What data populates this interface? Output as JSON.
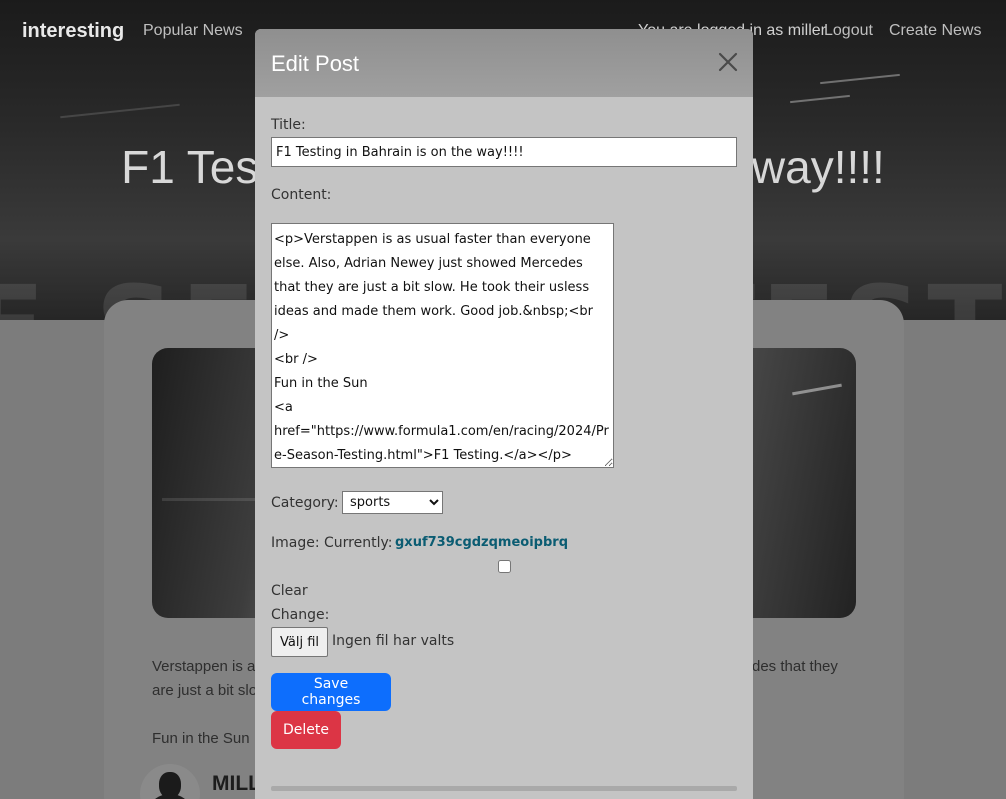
{
  "navbar": {
    "brand": "interesting",
    "links": [
      {
        "label": "Popular News"
      },
      {
        "label": "You are logged in as miller"
      },
      {
        "label": "Logout"
      },
      {
        "label": "Create News"
      }
    ]
  },
  "hero": {
    "title": "F1 Testing in Bahrain is on the way!!!!"
  },
  "post": {
    "body_line_1_left": "Verstappen is a",
    "body_line_1_right": "des that they",
    "body_line_2_left": "are just a bit slo",
    "body_line_3": "Fun in the Sun",
    "author_name": "MILL"
  },
  "modal": {
    "title": "Edit Post",
    "fields": {
      "title_label": "Title:",
      "title_value": "F1 Testing in Bahrain is on the way!!!!",
      "content_label": "Content:",
      "content_value": "<p>Verstappen is as usual faster than everyone else. Also, Adrian Newey just showed Mercedes that they are just a bit slow. He took their usless ideas and made them work. Good job.&nbsp;<br />\n<br />\nFun in the Sun\n<a href=\"https://www.formula1.com/en/racing/2024/Pre-Season-Testing.html\">F1 Testing.</a></p>",
      "category_label": "Category:",
      "category_value": "sports",
      "image_label": "Image: Currently:",
      "image_filename": "gxuf739cgdzqmeoipbrq",
      "clear_label": "Clear",
      "change_label": "Change:",
      "file_button_label": "Välj fil",
      "file_status": "Ingen fil har valts"
    },
    "buttons": {
      "save": "Save changes",
      "delete": "Delete"
    }
  },
  "colors": {
    "primary": "#0d6efd",
    "danger": "#dc3545",
    "link": "#0b5c72",
    "modal_bg": "#c4c4c4"
  },
  "icons": {
    "close": "close-icon",
    "avatar": "user-silhouette"
  }
}
